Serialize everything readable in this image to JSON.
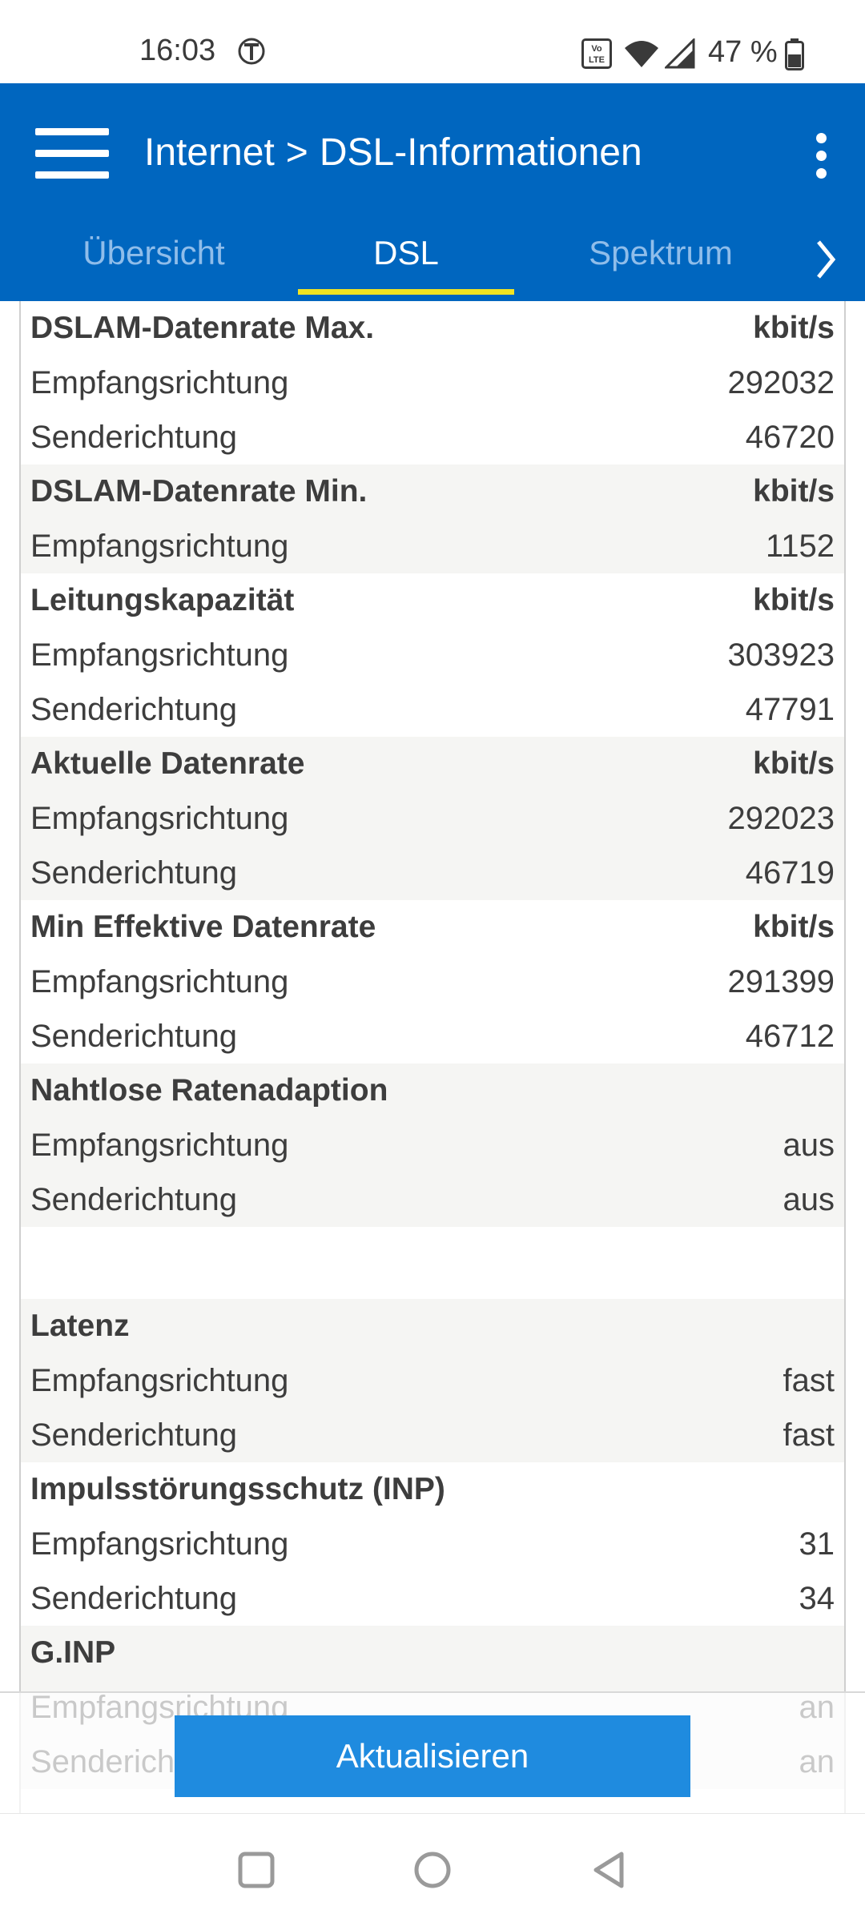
{
  "status_bar": {
    "time": "16:03",
    "volte_label": "Vo LTE",
    "battery_percent": "47 %",
    "icons": [
      "t-mobile-icon",
      "volte-icon",
      "wifi-icon",
      "signal-icon",
      "battery-icon"
    ]
  },
  "app_bar": {
    "breadcrumb": {
      "parent": "Internet",
      "separator": ">",
      "current": "DSL-Informationen"
    },
    "tabs": [
      {
        "label": "Übersicht",
        "active": false
      },
      {
        "label": "DSL",
        "active": true
      },
      {
        "label": "Spektrum",
        "active": false
      }
    ],
    "accent_color": "#0066bf",
    "tab_indicator_color": "#f2e422"
  },
  "groups": [
    {
      "title": "DSLAM-Datenrate Max.",
      "unit": "kbit/s",
      "shade": false,
      "rows": [
        {
          "label": "Empfangsrichtung",
          "value": "292032"
        },
        {
          "label": "Senderichtung",
          "value": "46720"
        }
      ]
    },
    {
      "title": "DSLAM-Datenrate Min.",
      "unit": "kbit/s",
      "shade": true,
      "rows": [
        {
          "label": "Empfangsrichtung",
          "value": "1152"
        }
      ]
    },
    {
      "title": "Leitungskapazität",
      "unit": "kbit/s",
      "shade": false,
      "rows": [
        {
          "label": "Empfangsrichtung",
          "value": "303923"
        },
        {
          "label": "Senderichtung",
          "value": "47791"
        }
      ]
    },
    {
      "title": "Aktuelle Datenrate",
      "unit": "kbit/s",
      "shade": true,
      "rows": [
        {
          "label": "Empfangsrichtung",
          "value": "292023"
        },
        {
          "label": "Senderichtung",
          "value": "46719"
        }
      ]
    },
    {
      "title": "Min Effektive Datenrate",
      "unit": "kbit/s",
      "shade": false,
      "rows": [
        {
          "label": "Empfangsrichtung",
          "value": "291399"
        },
        {
          "label": "Senderichtung",
          "value": "46712"
        }
      ]
    },
    {
      "title": "Nahtlose Ratenadaption",
      "unit": "",
      "shade": true,
      "rows": [
        {
          "label": "Empfangsrichtung",
          "value": "aus"
        },
        {
          "label": "Senderichtung",
          "value": "aus"
        }
      ]
    },
    {
      "title": "Latenz",
      "unit": "",
      "shade": true,
      "spacer_before": true,
      "rows": [
        {
          "label": "Empfangsrichtung",
          "value": "fast"
        },
        {
          "label": "Senderichtung",
          "value": "fast"
        }
      ]
    },
    {
      "title": "Impulsstörungsschutz (INP)",
      "unit": "",
      "shade": false,
      "rows": [
        {
          "label": "Empfangsrichtung",
          "value": "31"
        },
        {
          "label": "Senderichtung",
          "value": "34"
        }
      ]
    },
    {
      "title": "G.INP",
      "unit": "",
      "shade": true,
      "rows": [
        {
          "label": "Empfangsrichtung",
          "value": "an"
        },
        {
          "label": "Senderichtung",
          "value": "an"
        }
      ]
    }
  ],
  "update_button": {
    "label": "Aktualisieren",
    "color": "#1f8bdf"
  },
  "nav_bar": {
    "buttons": [
      "recents-icon",
      "home-icon",
      "back-icon"
    ]
  }
}
